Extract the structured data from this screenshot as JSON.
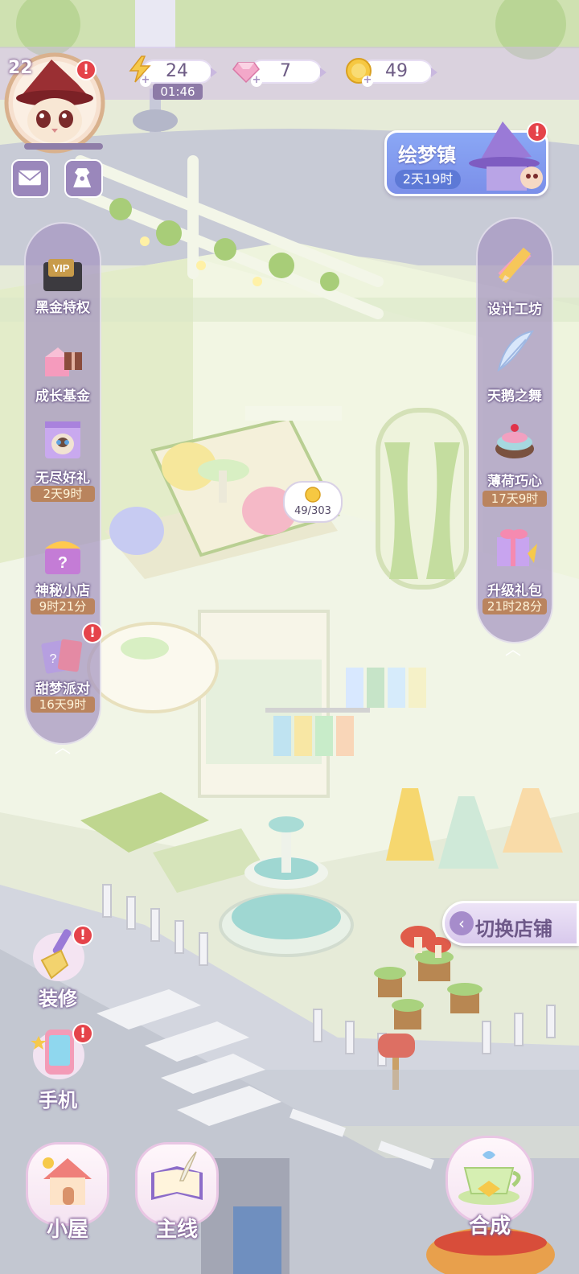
{
  "player": {
    "level": "22"
  },
  "resources": {
    "energy": {
      "value": "24",
      "timer": "01:46",
      "icon": "lightning-icon"
    },
    "gems": {
      "value": "7",
      "icon": "diamond-icon"
    },
    "coins": {
      "value": "49",
      "icon": "coin-icon"
    }
  },
  "event": {
    "name": "绘梦镇",
    "time": "2天19时"
  },
  "left_panel": [
    {
      "label": "黑金特权",
      "timer": "",
      "icon": "vip-card-icon"
    },
    {
      "label": "成长基金",
      "timer": "",
      "icon": "gift-box-icon"
    },
    {
      "label": "无尽好礼",
      "timer": "2天9时",
      "icon": "cat-gift-icon"
    },
    {
      "label": "神秘小店",
      "timer": "9时21分",
      "icon": "mystery-shop-icon"
    },
    {
      "label": "甜梦派对",
      "timer": "16天9时",
      "icon": "party-cards-icon"
    }
  ],
  "right_panel": [
    {
      "label": "设计工坊",
      "timer": "",
      "icon": "pencil-ruler-icon"
    },
    {
      "label": "天鹅之舞",
      "timer": "",
      "icon": "feather-icon"
    },
    {
      "label": "薄荷巧心",
      "timer": "17天9时",
      "icon": "cake-icon"
    },
    {
      "label": "升级礼包",
      "timer": "21时28分",
      "icon": "upgrade-gift-icon"
    }
  ],
  "shop_progress": "49/303",
  "switch_shop": "切换店铺",
  "tools": {
    "decorate": "装修",
    "phone": "手机"
  },
  "nav": {
    "house": "小屋",
    "main": "主线",
    "merge": "合成"
  },
  "colors": {
    "panel": "#a594c0",
    "badge": "#e5434a",
    "timer_bg": "#ba7e4e",
    "event_bg": "#8aa7f5"
  }
}
